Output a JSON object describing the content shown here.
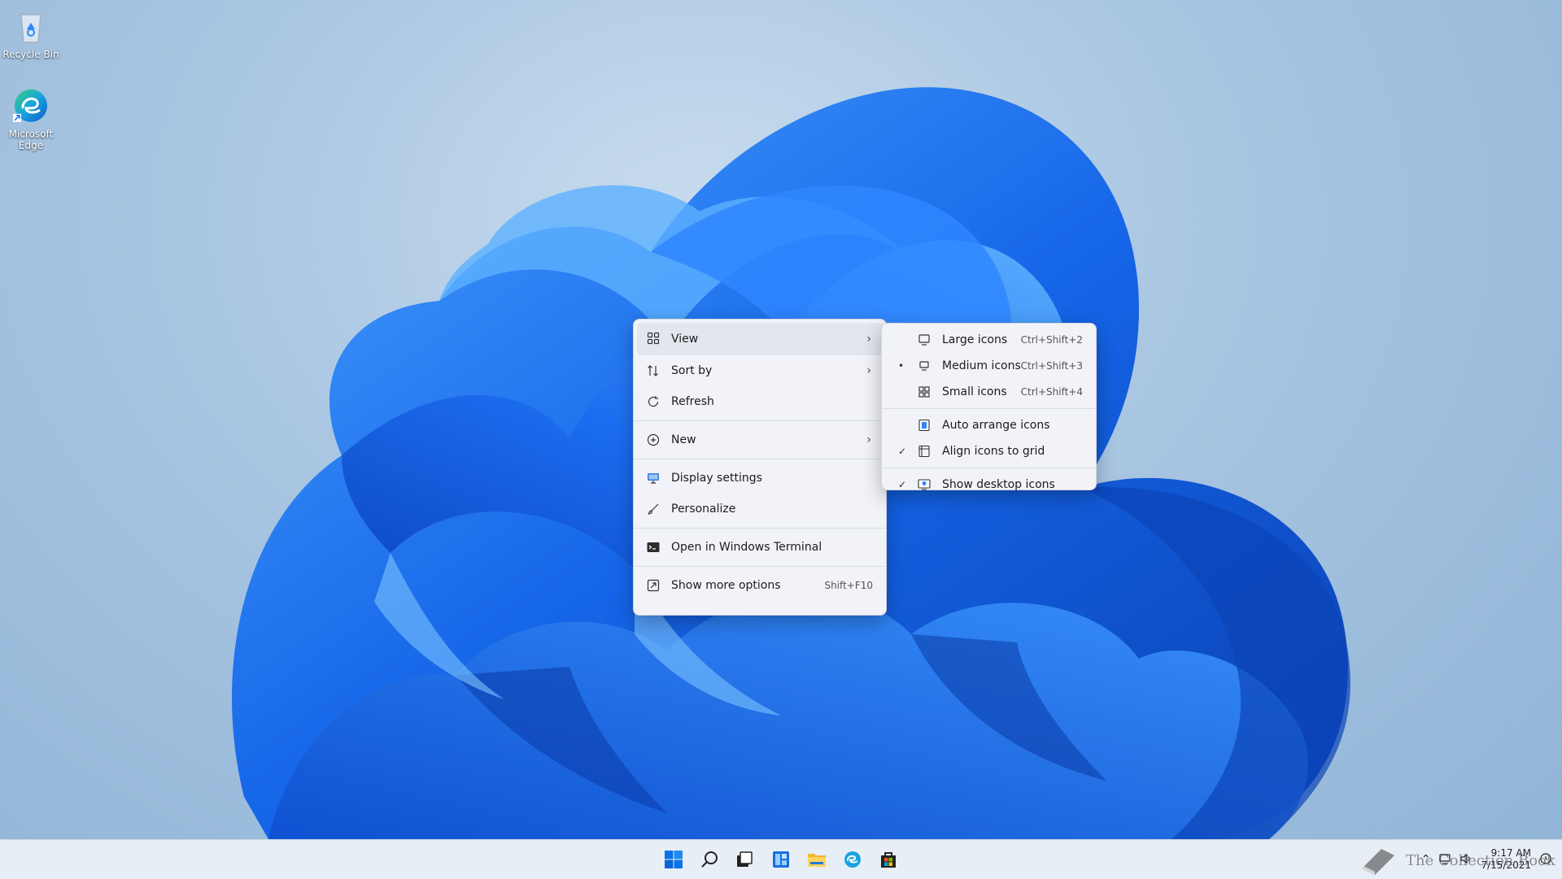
{
  "desktop": {
    "icons": [
      {
        "label": "Recycle Bin",
        "icon": "recycle-bin-icon"
      },
      {
        "label": "Microsoft Edge",
        "icon": "edge-icon"
      }
    ]
  },
  "context_menu": {
    "items": [
      {
        "label": "View",
        "icon": "grid-icon",
        "has_submenu": true
      },
      {
        "label": "Sort by",
        "icon": "sort-icon",
        "has_submenu": true
      },
      {
        "label": "Refresh",
        "icon": "refresh-icon"
      },
      {
        "label": "New",
        "icon": "plus-circle-icon",
        "has_submenu": true
      },
      {
        "label": "Display settings",
        "icon": "display-icon"
      },
      {
        "label": "Personalize",
        "icon": "brush-icon"
      },
      {
        "label": "Open in Windows Terminal",
        "icon": "terminal-icon"
      },
      {
        "label": "Show more options",
        "icon": "more-options-icon",
        "shortcut": "Shift+F10"
      }
    ]
  },
  "view_submenu": {
    "items": [
      {
        "label": "Large icons",
        "shortcut": "Ctrl+Shift+2",
        "icon": "monitor-icon",
        "state": ""
      },
      {
        "label": "Medium icons",
        "shortcut": "Ctrl+Shift+3",
        "icon": "monitor-icon",
        "state": "•"
      },
      {
        "label": "Small icons",
        "shortcut": "Ctrl+Shift+4",
        "icon": "small-grid-icon",
        "state": ""
      },
      {
        "label": "Auto arrange icons",
        "icon": "auto-arrange-icon",
        "state": ""
      },
      {
        "label": "Align icons to grid",
        "icon": "align-grid-icon",
        "state": "✓"
      },
      {
        "label": "Show desktop icons",
        "icon": "show-desktop-icon",
        "state": "✓"
      }
    ]
  },
  "taskbar": {
    "pinned": [
      "start-icon",
      "search-icon",
      "task-view-icon",
      "widgets-icon",
      "file-explorer-icon",
      "edge-icon",
      "store-icon"
    ],
    "clock_time": "9:17 AM",
    "clock_date": "7/15/2021",
    "watermark": "The Collection Book"
  },
  "colors": {
    "accent": "#0a5fd8",
    "wallpaper_blue": "#1e6ff0",
    "menu_bg": "#f1f3f9"
  }
}
